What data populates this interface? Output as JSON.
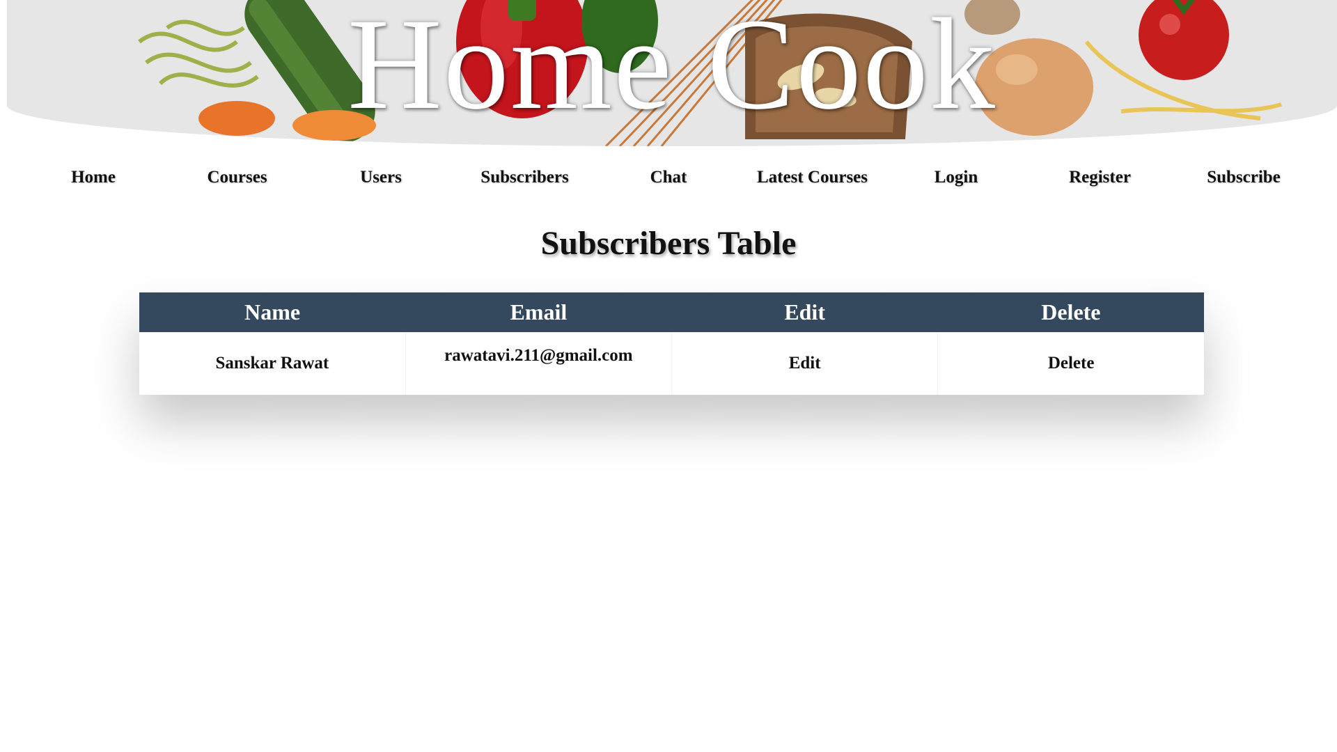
{
  "banner": {
    "title": "Home Cook"
  },
  "nav": {
    "items": [
      {
        "label": "Home"
      },
      {
        "label": "Courses"
      },
      {
        "label": "Users"
      },
      {
        "label": "Subscribers"
      },
      {
        "label": "Chat"
      },
      {
        "label": "Latest Courses"
      },
      {
        "label": "Login"
      },
      {
        "label": "Register"
      },
      {
        "label": "Subscribe"
      }
    ]
  },
  "page": {
    "heading": "Subscribers Table"
  },
  "table": {
    "header_color": "#34495e",
    "columns": [
      "Name",
      "Email",
      "Edit",
      "Delete"
    ],
    "rows": [
      {
        "name": "Sanskar Rawat",
        "email": "rawatavi.211@gmail.com",
        "edit": "Edit",
        "delete": "Delete"
      }
    ]
  }
}
